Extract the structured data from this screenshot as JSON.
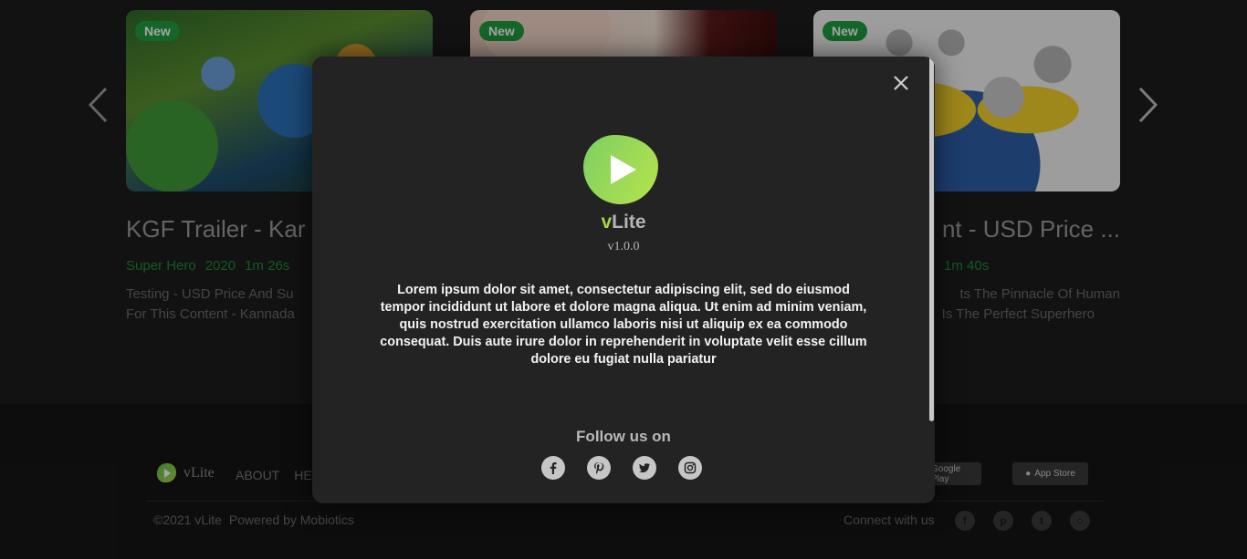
{
  "carousel": {
    "cards": [
      {
        "badge": "New",
        "title": "KGF Trailer - Kar",
        "genre": "Super Hero",
        "year": "2020",
        "duration": "1m 26s",
        "desc_line1": "Testing - USD Price And Su",
        "desc_line2": "For This Content - Kannada"
      },
      {
        "badge": "New"
      },
      {
        "badge": "New",
        "title": "nt - USD Price ...",
        "duration": "1m 40s",
        "desc_line1": "ts The Pinnacle Of Human",
        "desc_line2": "Is The Perfect Superhero"
      }
    ]
  },
  "footer": {
    "brand": "vLite",
    "nav": [
      "ABOUT",
      "HE"
    ],
    "google_play": "Google Play",
    "app_store": "App Store",
    "copyright": "©2021 vLite",
    "powered_by": "Powered by Mobiotics",
    "connect_label": "Connect with us"
  },
  "modal": {
    "app_name_prefix": "v",
    "app_name_rest": "Lite",
    "version": "v1.0.0",
    "about_text": "Lorem ipsum dolor sit amet, consectetur adipiscing elit, sed do eiusmod tempor incididunt ut labore et dolore magna aliqua. Ut enim ad minim veniam, quis nostrud exercitation ullamco laboris nisi ut aliquip ex ea commodo consequat. Duis aute irure dolor in reprehenderit in voluptate velit esse cillum dolore eu fugiat nulla pariatur",
    "follow_title": "Follow us on",
    "social_icons": [
      "facebook-icon",
      "pinterest-icon",
      "twitter-icon",
      "instagram-icon"
    ]
  },
  "colors": {
    "accent_green": "#a5d44b",
    "badge_green": "#1f9d3f",
    "modal_bg": "#232324"
  }
}
